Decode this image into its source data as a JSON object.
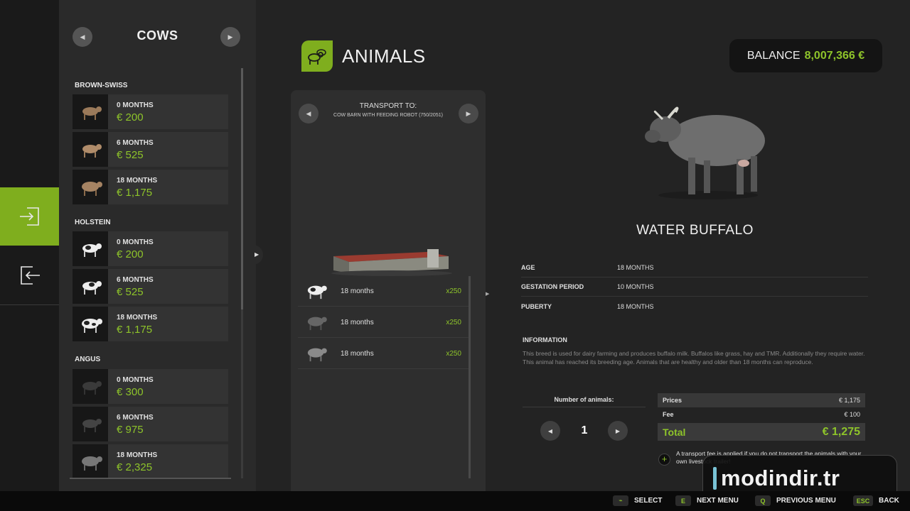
{
  "shop": {
    "title": "COWS",
    "categories": [
      {
        "name": "BROWN-SWISS",
        "items": [
          {
            "age": "0 MONTHS",
            "price": "€ 200"
          },
          {
            "age": "6 MONTHS",
            "price": "€ 525"
          },
          {
            "age": "18 MONTHS",
            "price": "€ 1,175"
          }
        ]
      },
      {
        "name": "HOLSTEIN",
        "items": [
          {
            "age": "0 MONTHS",
            "price": "€ 200"
          },
          {
            "age": "6 MONTHS",
            "price": "€ 525"
          },
          {
            "age": "18 MONTHS",
            "price": "€ 1,175"
          }
        ]
      },
      {
        "name": "ANGUS",
        "items": [
          {
            "age": "0 MONTHS",
            "price": "€ 300"
          },
          {
            "age": "6 MONTHS",
            "price": "€ 975"
          },
          {
            "age": "18 MONTHS",
            "price": "€ 2,325"
          }
        ]
      }
    ]
  },
  "header": {
    "title": "ANIMALS"
  },
  "balance": {
    "label": "BALANCE",
    "value": "8,007,366 €"
  },
  "transport": {
    "label": "TRANSPORT TO:",
    "destination": "COW BARN WITH FEEDING ROBOT (750/2051)",
    "rows": [
      {
        "text": "18 months",
        "count": "x250"
      },
      {
        "text": "18 months",
        "count": "x250"
      },
      {
        "text": "18 months",
        "count": "x250"
      }
    ]
  },
  "detail": {
    "name": "WATER BUFFALO",
    "stats": [
      {
        "key": "AGE",
        "value": "18 MONTHS"
      },
      {
        "key": "GESTATION PERIOD",
        "value": "10 MONTHS"
      },
      {
        "key": "PUBERTY",
        "value": "18 MONTHS"
      }
    ],
    "info_title": "INFORMATION",
    "info_text": "This breed is used for dairy farming and produces buffalo milk. Buffalos like grass, hay and TMR. Additionally they require water. This animal has reached its breeding age. Animals that are healthy and older than 18 months can reproduce."
  },
  "purchase": {
    "num_label": "Number of animals:",
    "quantity": "1",
    "prices_label": "Prices",
    "prices_value": "€ 1,175",
    "fee_label": "Fee",
    "fee_value": "€ 100",
    "total_label": "Total",
    "total_value": "€ 1,275",
    "fee_note": "A transport fee is applied if you do not transport the animals with your own livestock trailer!"
  },
  "watermark": {
    "text": "modindir.tr"
  },
  "footer": {
    "select": "SELECT",
    "next_key": "E",
    "next": "NEXT MENU",
    "prev_key": "Q",
    "prev": "PREVIOUS MENU",
    "back_key": "ESC",
    "back": "BACK"
  },
  "colors": {
    "accent": "#7fae1e",
    "price_green": "#8ec42a"
  }
}
